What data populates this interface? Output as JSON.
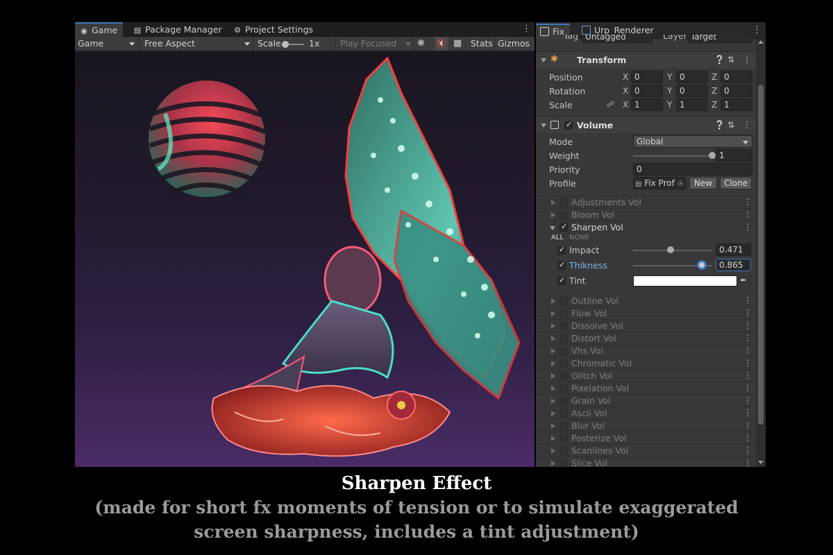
{
  "game_window": {
    "tabs": [
      {
        "label": "Game",
        "icon": "gamepad-icon"
      },
      {
        "label": "Package Manager",
        "icon": "package-icon"
      },
      {
        "label": "Project Settings",
        "icon": "gear-icon"
      }
    ],
    "toolbar": {
      "display": "Game",
      "aspect": "Free Aspect",
      "scale_label": "Scale",
      "scale_value": "1x",
      "play_mode": "Play Focused",
      "stats": "Stats",
      "gizmos": "Gizmos"
    }
  },
  "inspector": {
    "tabs": [
      {
        "label": "Fix",
        "icon": "cube-icon"
      },
      {
        "label": "Urp_Renderer",
        "icon": "prefab-icon"
      }
    ],
    "tag_label": "Tag",
    "tag_value": "Untagged",
    "layer_label": "Layer",
    "layer_value": "Target",
    "transform": {
      "title": "Transform",
      "rows": [
        {
          "label": "Position",
          "x": "0",
          "y": "0",
          "z": "0"
        },
        {
          "label": "Rotation",
          "x": "0",
          "y": "0",
          "z": "0"
        },
        {
          "label": "Scale",
          "x": "1",
          "y": "1",
          "z": "1"
        }
      ],
      "axis_x": "X",
      "axis_y": "Y",
      "axis_z": "Z"
    },
    "volume": {
      "title": "Volume",
      "mode_label": "Mode",
      "mode_value": "Global",
      "weight_label": "Weight",
      "weight_value": "1",
      "weight_fraction": 1.0,
      "priority_label": "Priority",
      "priority_value": "0",
      "profile_label": "Profile",
      "profile_value": "Fix Prof",
      "new_button": "New",
      "clone_button": "Clone"
    },
    "volumes_before": [
      {
        "label": "Adjustments Vol",
        "enabled": false
      },
      {
        "label": "Bloom Vol",
        "enabled": false
      }
    ],
    "sharpen": {
      "label": "Sharpen Vol",
      "enabled": true,
      "all": "ALL",
      "none": "NONE",
      "impact_label": "Impact",
      "impact_value": "0.471",
      "thikness_label": "Thikness",
      "thikness_value": "0.865",
      "tint_label": "Tint",
      "tint_color": "#ffffff"
    },
    "volumes_after": [
      {
        "label": "Outline Vol",
        "enabled": false
      },
      {
        "label": "Flow Vol",
        "enabled": false
      },
      {
        "label": "Dissolve Vol",
        "enabled": false
      },
      {
        "label": "Distort Vol",
        "enabled": false
      },
      {
        "label": "Vhs Vol",
        "enabled": false
      },
      {
        "label": "Chromatic Vol",
        "enabled": false
      },
      {
        "label": "Glitch Vol",
        "enabled": false
      },
      {
        "label": "Pixelation Vol",
        "enabled": false
      },
      {
        "label": "Grain Vol",
        "enabled": false
      },
      {
        "label": "Ascii Vol",
        "enabled": false
      },
      {
        "label": "Blur Vol",
        "enabled": false
      },
      {
        "label": "Posterize Vol",
        "enabled": false
      },
      {
        "label": "Scanlines Vol",
        "enabled": false
      },
      {
        "label": "Slice Vol",
        "enabled": false
      }
    ]
  },
  "caption": {
    "title": "Sharpen Effect",
    "line1": "(made for short fx moments of tension or to simulate exaggerated",
    "line2": "screen sharpness, includes a tint adjustment)"
  },
  "colors": {
    "accent": "#3a79bb",
    "panel_bg": "#383838",
    "viewport_bottom": "#4a2b66"
  }
}
